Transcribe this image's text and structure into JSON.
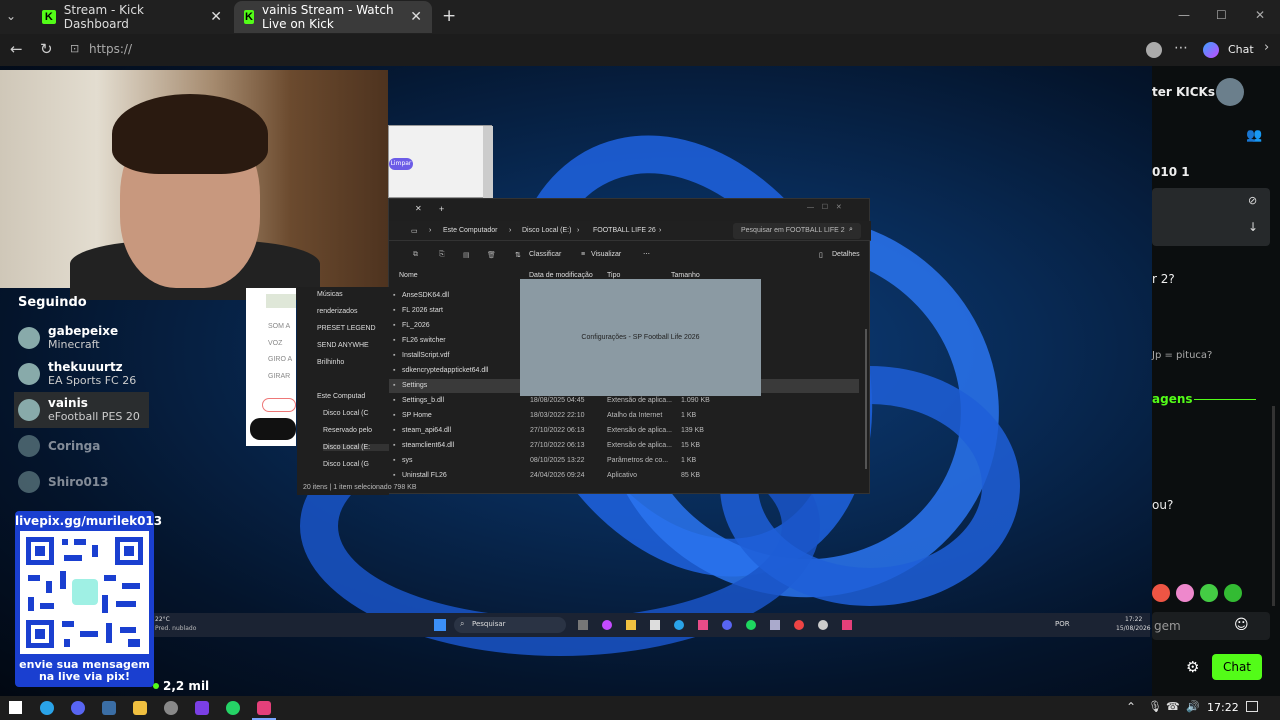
{
  "tabs": [
    {
      "label": "Stream - Kick Dashboard",
      "close": "✕"
    },
    {
      "label": "vainis Stream - Watch Live on Kick",
      "close": "✕"
    }
  ],
  "new_tab": "+",
  "url": "https://",
  "chat_button": "Chat",
  "window_controls": {
    "minimize": "—",
    "maximize": "☐",
    "close": "✕"
  },
  "followed": {
    "heading": "Seguindo",
    "channels": [
      {
        "name": "gabepeixe",
        "game": "Minecraft"
      },
      {
        "name": "thekuuurtz",
        "game": "EA Sports FC 26"
      },
      {
        "name": "vainis",
        "game": "eFootball PES 20"
      },
      {
        "name": "Coringa",
        "game": ""
      },
      {
        "name": "Shiro013",
        "game": ""
      }
    ]
  },
  "qr": {
    "link": "livepix.gg/murilek013",
    "caption": "envie sua mensagem na live via pix!"
  },
  "viewers": "2,2 mil",
  "browser_popup": {
    "button": "Limpar"
  },
  "obs_panel": [
    "SOM A",
    "VOZ",
    "GIRO A",
    "GIRAR"
  ],
  "explorer": {
    "breadcrumb": [
      "Este Computador",
      "Disco Local (E:)",
      "FOOTBALL LIFE 26"
    ],
    "search": "Pesquisar em FOOTBALL LIFE 2",
    "toolbar": {
      "sort": "Classificar",
      "view": "Visualizar",
      "details": "Detalhes"
    },
    "columns": [
      "Nome",
      "Data de modificação",
      "Tipo",
      "Tamanho"
    ],
    "nav": [
      "Músicas",
      "renderizados",
      "PRESET LEGEND",
      "SEND ANYWHE",
      "Brilhinho",
      "Este Computad",
      "Disco Local (C",
      "Reservado pelo",
      "Disco Local (E:",
      "Disco Local (G"
    ],
    "files": [
      {
        "name": "AnseSDK64.dll",
        "date": "",
        "type": "",
        "size": ""
      },
      {
        "name": "FL 2026 start",
        "date": "",
        "type": "",
        "size": ""
      },
      {
        "name": "FL_2026",
        "date": "",
        "type": "",
        "size": ""
      },
      {
        "name": "FL26 switcher",
        "date": "",
        "type": "",
        "size": ""
      },
      {
        "name": "InstallScript.vdf",
        "date": "",
        "type": "",
        "size": ""
      },
      {
        "name": "sdkencryptedappticket64.dll",
        "date": "",
        "type": "",
        "size": ""
      },
      {
        "name": "Settings",
        "date": "",
        "type": "",
        "size": ""
      },
      {
        "name": "Settings_b.dll",
        "date": "18/08/2025 04:45",
        "type": "Extensão de aplica...",
        "size": "1.090 KB"
      },
      {
        "name": "SP Home",
        "date": "18/03/2022 22:10",
        "type": "Atalho da Internet",
        "size": "1 KB"
      },
      {
        "name": "steam_api64.dll",
        "date": "27/10/2022 06:13",
        "type": "Extensão de aplica...",
        "size": "139 KB"
      },
      {
        "name": "steamclient64.dll",
        "date": "27/10/2022 06:13",
        "type": "Extensão de aplica...",
        "size": "15 KB"
      },
      {
        "name": "sys",
        "date": "08/10/2025 13:22",
        "type": "Parâmetros de co...",
        "size": "1 KB"
      },
      {
        "name": "Uninstall FL26",
        "date": "24/04/2026 09:24",
        "type": "Aplicativo",
        "size": "85 KB"
      }
    ],
    "status": "20 itens | 1 item selecionado 798 KB",
    "dialog": "Configurações - SP Football Life 2026"
  },
  "stream_taskbar": {
    "weather": "22°C",
    "weather_desc": "Pred. nublado",
    "search": "Pesquisar",
    "lang": "POR",
    "time": "17:22",
    "date": "15/08/2026"
  },
  "chat": {
    "title": "ter KICKs",
    "line1": "010 1",
    "line2": "r 2?",
    "line3": "Jp = pituca?",
    "line4": "agens",
    "line5": "ou?",
    "input": "gem",
    "send": "Chat"
  },
  "system_tray": {
    "time": "17:22"
  },
  "colors": {
    "kick_green": "#53fc18",
    "qr_blue": "#1a3fd0"
  }
}
